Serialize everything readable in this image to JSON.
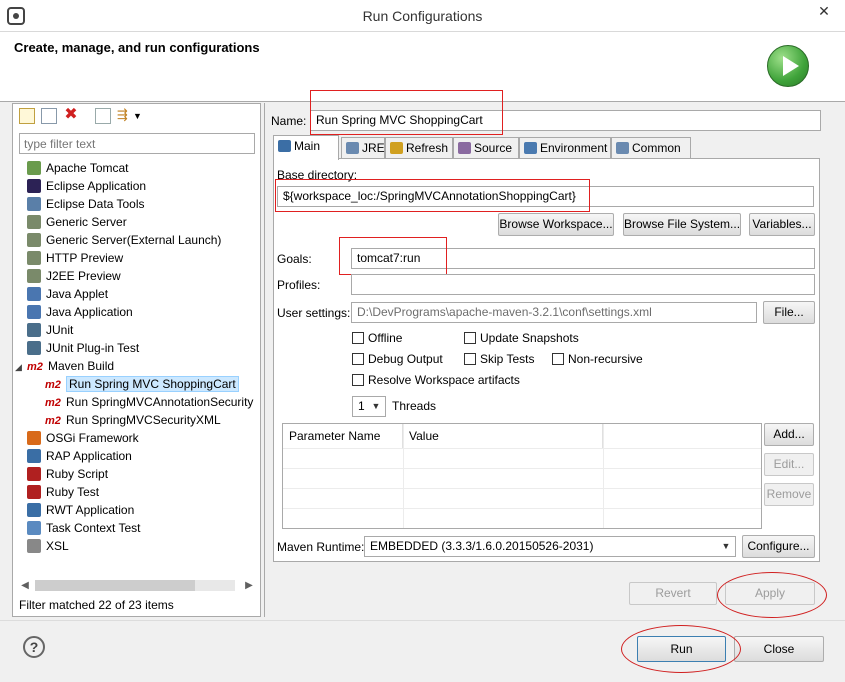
{
  "window": {
    "title": "Run Configurations",
    "close_glyph": "✕"
  },
  "header": {
    "heading": "Create, manage, and run configurations",
    "logo_icon": "run-play-icon"
  },
  "left": {
    "filter_placeholder": "type filter text",
    "tree": [
      {
        "label": "Apache Tomcat",
        "icon": "tomcat-icon",
        "color": "#6a9b4d",
        "level": 0
      },
      {
        "label": "Eclipse Application",
        "icon": "eclipse-icon",
        "color": "#2c2255",
        "level": 0
      },
      {
        "label": "Eclipse Data Tools",
        "icon": "data-tools-icon",
        "color": "#5a7fa8",
        "level": 0
      },
      {
        "label": "Generic Server",
        "icon": "server-icon",
        "color": "#7a8a6a",
        "level": 0
      },
      {
        "label": "Generic Server(External Launch)",
        "icon": "server-icon",
        "color": "#7a8a6a",
        "level": 0
      },
      {
        "label": "HTTP Preview",
        "icon": "http-icon",
        "color": "#7a8a6a",
        "level": 0
      },
      {
        "label": "J2EE Preview",
        "icon": "j2ee-icon",
        "color": "#7a8a6a",
        "level": 0
      },
      {
        "label": "Java Applet",
        "icon": "applet-icon",
        "color": "#4a76b0",
        "level": 0
      },
      {
        "label": "Java Application",
        "icon": "java-app-icon",
        "color": "#4a76b0",
        "level": 0
      },
      {
        "label": "JUnit",
        "icon": "junit-icon",
        "color": "#4a6e8a",
        "level": 0
      },
      {
        "label": "JUnit Plug-in Test",
        "icon": "junit-icon",
        "color": "#4a6e8a",
        "level": 0
      },
      {
        "label": "Maven Build",
        "icon": "m2-icon",
        "level": 0,
        "expanded": true
      },
      {
        "label": "Run Spring MVC ShoppingCart",
        "icon": "m2-icon",
        "level": 1,
        "selected": true
      },
      {
        "label": "Run SpringMVCAnnotationSecurity",
        "icon": "m2-icon",
        "level": 1
      },
      {
        "label": "Run SpringMVCSecurityXML",
        "icon": "m2-icon",
        "level": 1
      },
      {
        "label": "OSGi Framework",
        "icon": "osgi-icon",
        "color": "#d86a1a",
        "level": 0
      },
      {
        "label": "RAP Application",
        "icon": "rap-icon",
        "color": "#3a6ea5",
        "level": 0
      },
      {
        "label": "Ruby Script",
        "icon": "ruby-icon",
        "color": "#b02020",
        "level": 0
      },
      {
        "label": "Ruby Test",
        "icon": "ruby-test-icon",
        "color": "#b02020",
        "level": 0
      },
      {
        "label": "RWT Application",
        "icon": "rwt-icon",
        "color": "#3a6ea5",
        "level": 0
      },
      {
        "label": "Task Context Test",
        "icon": "task-icon",
        "color": "#5a8ac0",
        "level": 0
      },
      {
        "label": "XSL",
        "icon": "xsl-icon",
        "color": "#888888",
        "level": 0
      }
    ],
    "status": "Filter matched 22 of 23 items"
  },
  "right": {
    "name_label": "Name:",
    "name_value": "Run Spring MVC ShoppingCart",
    "tabs": [
      {
        "label": "Main",
        "icon": "main-tab-icon",
        "color": "#3b6ea5"
      },
      {
        "label": "JRE",
        "icon": "jre-icon",
        "color": "#6a8ab0"
      },
      {
        "label": "Refresh",
        "icon": "refresh-icon",
        "color": "#d0a020"
      },
      {
        "label": "Source",
        "icon": "source-icon",
        "color": "#8a6aa0"
      },
      {
        "label": "Environment",
        "icon": "environment-icon",
        "color": "#4a7ab0"
      },
      {
        "label": "Common",
        "icon": "common-icon",
        "color": "#6a8ab0"
      }
    ],
    "base_dir_label": "Base directory:",
    "base_dir_value": "${workspace_loc:/SpringMVCAnnotationShoppingCart}",
    "browse_workspace": "Browse Workspace...",
    "browse_fs": "Browse File System...",
    "variables": "Variables...",
    "goals_label": "Goals:",
    "goals_value": "tomcat7:run",
    "profiles_label": "Profiles:",
    "profiles_value": "",
    "user_settings_label": "User settings:",
    "user_settings_value": "D:\\DevPrograms\\apache-maven-3.2.1\\conf\\settings.xml",
    "file_btn": "File...",
    "checks": {
      "offline": "Offline",
      "update_snapshots": "Update Snapshots",
      "debug_output": "Debug Output",
      "skip_tests": "Skip Tests",
      "non_recursive": "Non-recursive",
      "resolve_workspace": "Resolve Workspace artifacts"
    },
    "threads_value": "1",
    "threads_label": "Threads",
    "table_headers": [
      "Parameter Name",
      "Value"
    ],
    "add_btn": "Add...",
    "edit_btn": "Edit...",
    "remove_btn": "Remove",
    "maven_runtime_label": "Maven Runtime:",
    "maven_runtime_value": "EMBEDDED (3.3.3/1.6.0.20150526-2031)",
    "configure_btn": "Configure...",
    "revert_btn": "Revert",
    "apply_btn": "Apply"
  },
  "bottom": {
    "help_glyph": "?",
    "run_btn": "Run",
    "close_btn": "Close"
  }
}
